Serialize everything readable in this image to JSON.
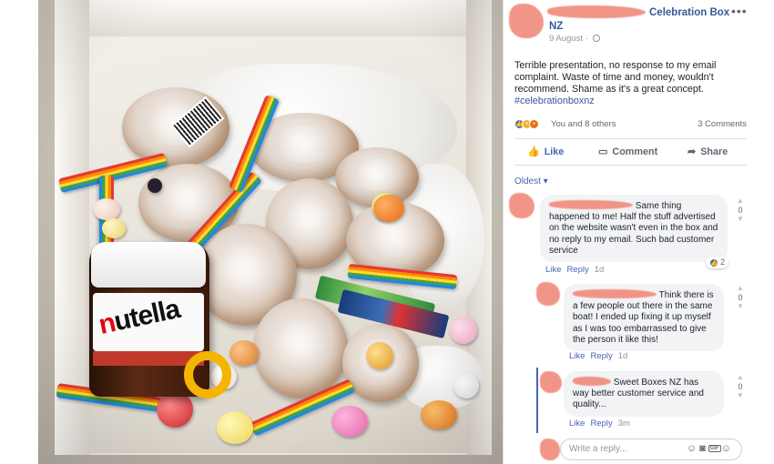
{
  "post": {
    "page_name": "Celebration Box",
    "page_name_line2": "NZ",
    "more_label": "•••",
    "date": "9 August",
    "body": "Terrible presentation, no response to my email complaint. Waste of time and money, wouldn't recommend. Shame as it's a great concept.",
    "hashtag": "#celebrationboxnz",
    "reactions_text": "You and 8 others",
    "comments_count": "3 Comments"
  },
  "actions": {
    "like": "Like",
    "comment": "Comment",
    "share": "Share"
  },
  "sort_label": "Oldest ▾",
  "comments": [
    {
      "text": "Same thing happened to me! Half the stuff advertised on the website wasn't even in the box and no reply to my email. Such bad customer service",
      "like": "Like",
      "reply": "Reply",
      "time": "1d",
      "votes": "0",
      "likes_badge": "2"
    },
    {
      "text": "Think there is a few people out there in the same boat! I ended up fixing it up myself as I was too embarrassed to give the person it like this!",
      "like": "Like",
      "reply": "Reply",
      "time": "1d",
      "votes": "0"
    },
    {
      "text": "Sweet Boxes NZ has way better customer service and quality...",
      "like": "Like",
      "reply": "Reply",
      "time": "3m",
      "votes": "0"
    }
  ],
  "reply_box": {
    "placeholder": "Write a reply..."
  },
  "photo": {
    "jar_brand_prefix": "n",
    "jar_brand_rest": "utella"
  }
}
